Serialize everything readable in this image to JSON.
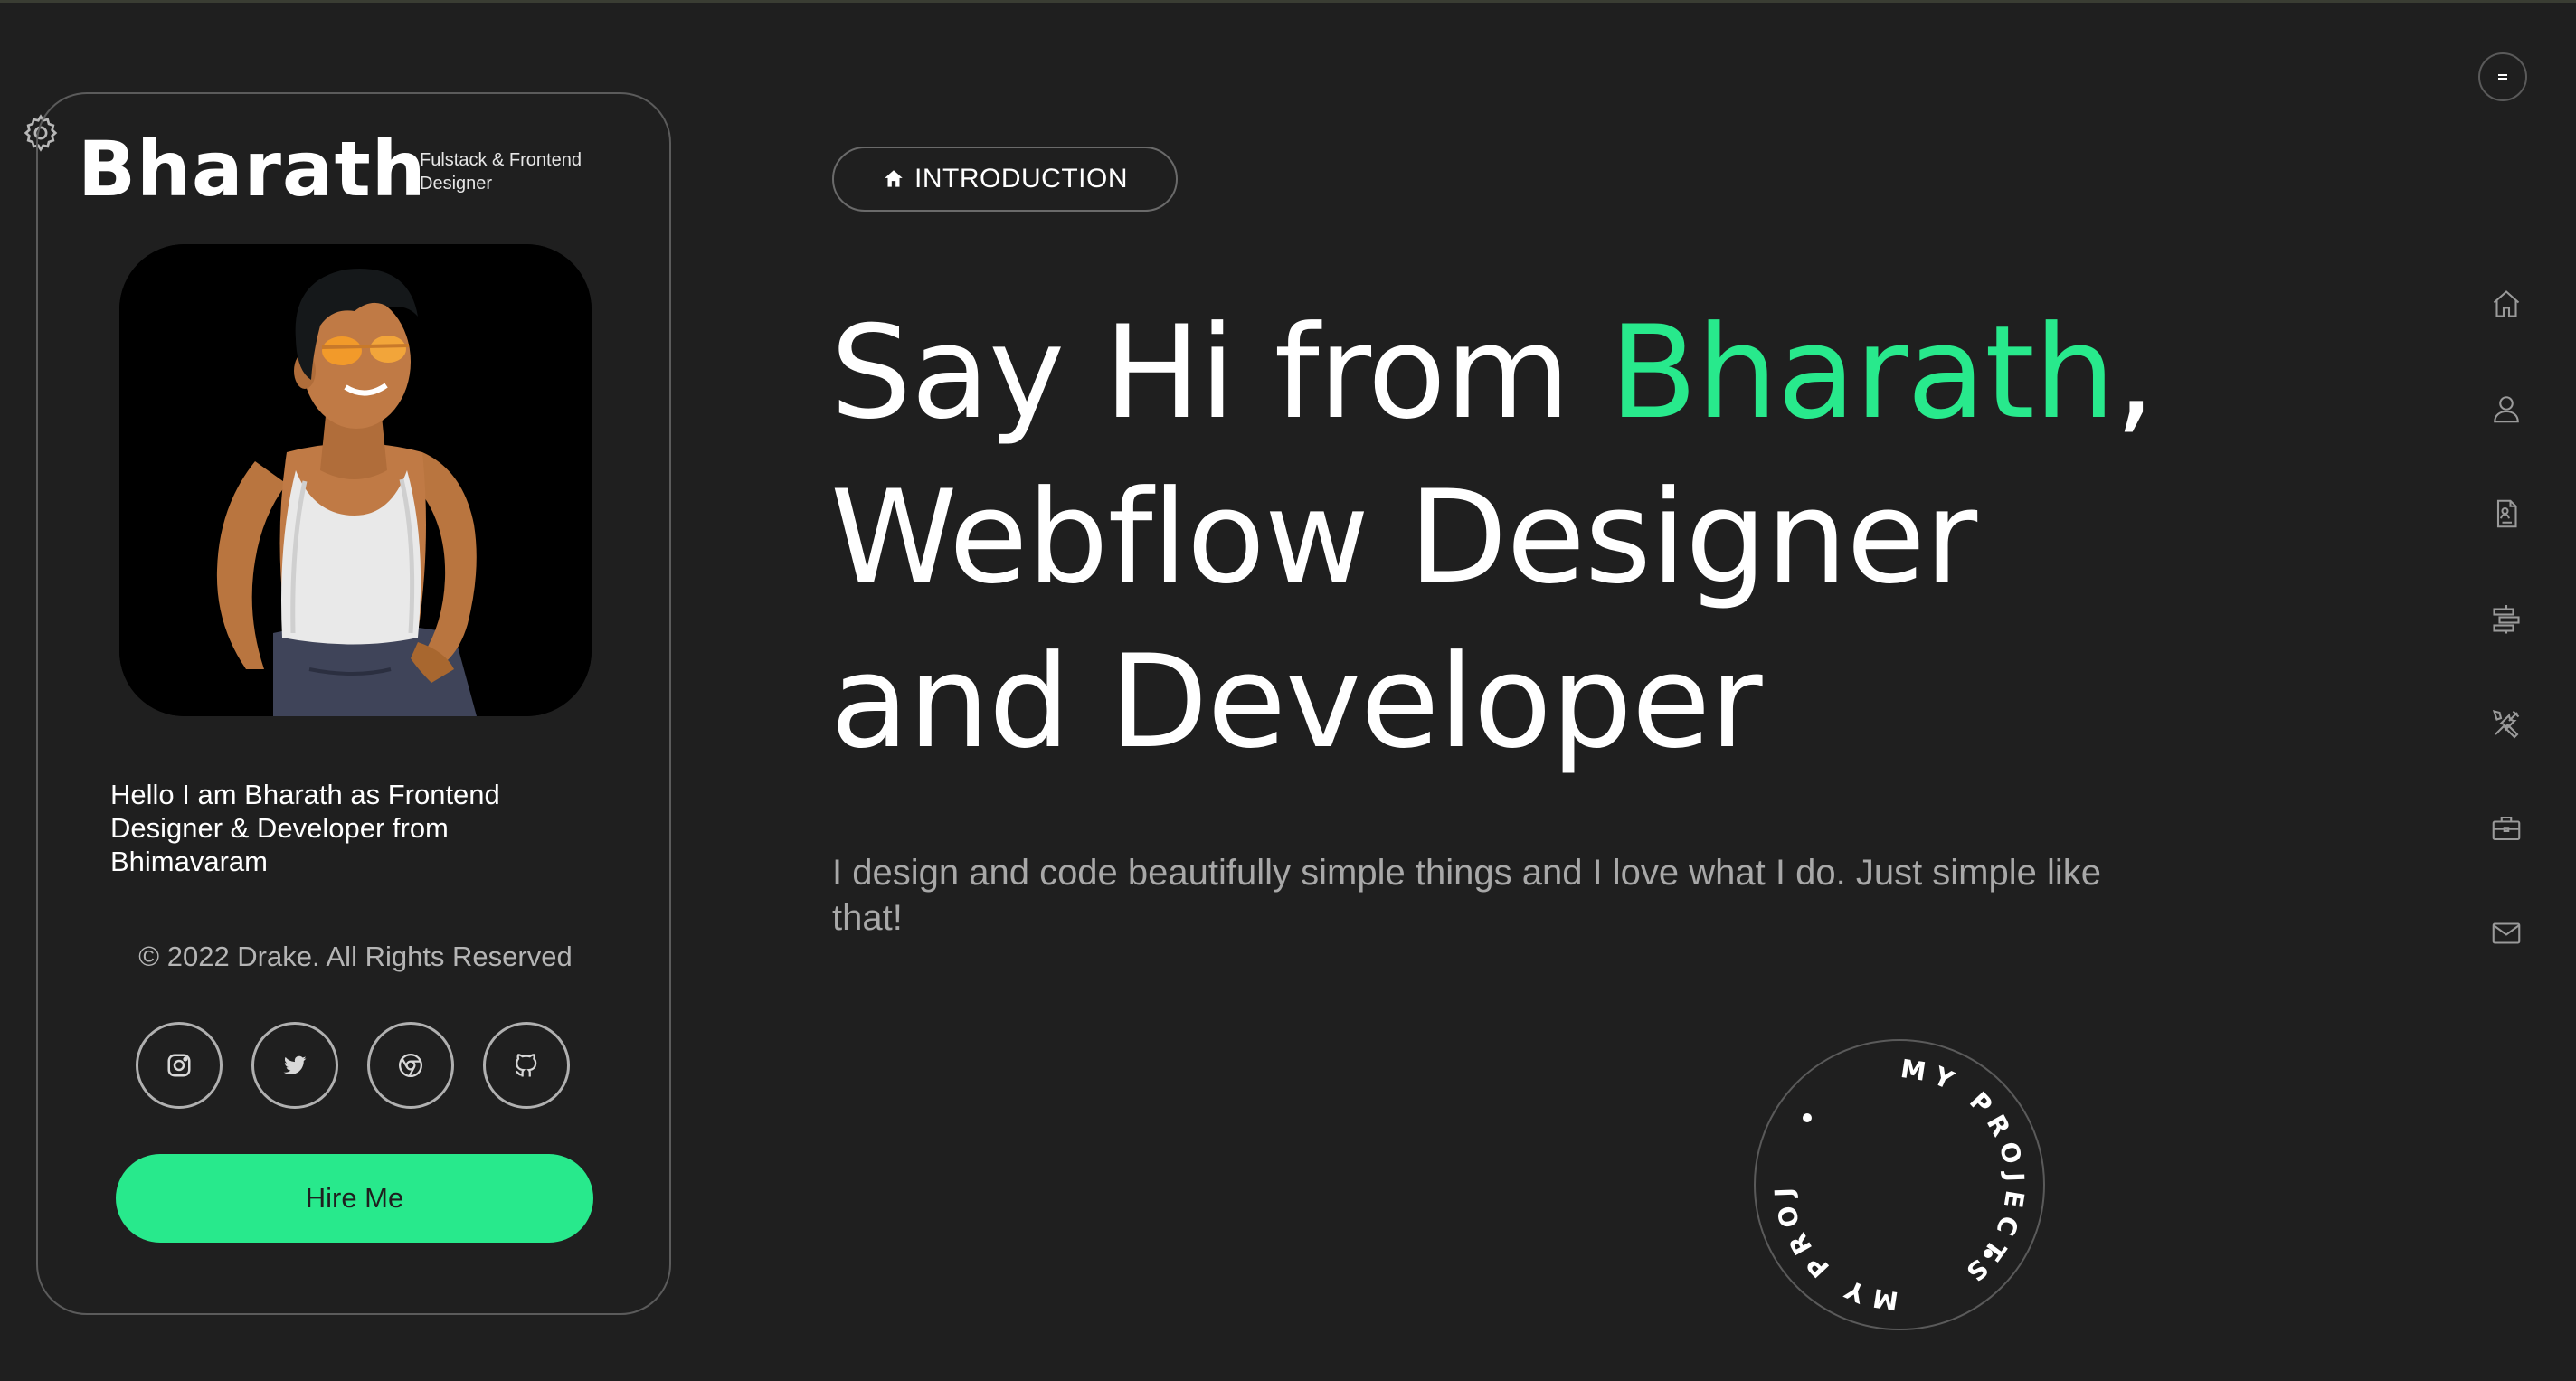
{
  "profile": {
    "name": "Bharath",
    "tagline": "Fulstack & Frontend Designer",
    "bio": "Hello I am Bharath as Frontend Designer & Developer from Bhimavaram",
    "copyright": "© 2022 Drake. All Rights Reserved",
    "hire_label": "Hire Me",
    "socials": [
      {
        "icon": "instagram-icon"
      },
      {
        "icon": "twitter-icon"
      },
      {
        "icon": "chrome-icon"
      },
      {
        "icon": "github-icon"
      }
    ]
  },
  "hero": {
    "section_label": "INTRODUCTION",
    "headline_part1": "Say Hi from ",
    "headline_name": "Bharath",
    "headline_part2": ",",
    "headline_line2": "Webflow Designer",
    "headline_line3": "and Developer",
    "lead": "I design and code beautifully simple things and I love what I do. Just simple like that!",
    "badge_text": "MY PROJECTS"
  },
  "nav": {
    "items": [
      {
        "icon": "home-icon"
      },
      {
        "icon": "user-icon"
      },
      {
        "icon": "resume-icon"
      },
      {
        "icon": "services-icon"
      },
      {
        "icon": "skills-icon"
      },
      {
        "icon": "portfolio-icon"
      },
      {
        "icon": "mail-icon"
      }
    ]
  },
  "colors": {
    "accent": "#28e98c",
    "background": "#1f1f1f"
  }
}
